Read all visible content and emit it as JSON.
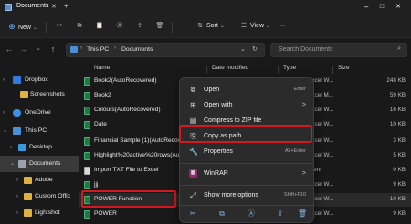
{
  "window": {
    "title": "Documents"
  },
  "toolbar": {
    "new_label": "New",
    "sort_label": "Sort",
    "view_label": "View",
    "more_label": "···"
  },
  "address": {
    "path": [
      "This PC",
      "Documents"
    ],
    "search_placeholder": "Search Documents"
  },
  "sidebar": {
    "items": [
      {
        "label": "Dropbox",
        "expanded": false
      },
      {
        "label": "Screenshots",
        "expanded": false
      },
      {
        "label": "OneDrive",
        "expanded": false
      },
      {
        "label": "This PC",
        "expanded": true
      },
      {
        "label": "Desktop",
        "expanded": false
      },
      {
        "label": "Documents",
        "expanded": true,
        "selected": true
      },
      {
        "label": "Adobe",
        "expanded": false
      },
      {
        "label": "Custom Offic",
        "expanded": false
      },
      {
        "label": "Lightshot",
        "expanded": false
      }
    ]
  },
  "columns": {
    "name": "Name",
    "date": "Date modified",
    "type": "Type",
    "size": "Size"
  },
  "files": [
    {
      "name": "Book2(AutoRecovered)",
      "date": "",
      "type": "Microsoft Excel W...",
      "size": "248 KB",
      "icon": "excel-icon"
    },
    {
      "name": "Book2",
      "date": "",
      "type": "Microsoft Excel M...",
      "size": "59 KB",
      "icon": "excel-icon"
    },
    {
      "name": "Colours(AutoRecovered)",
      "date": "",
      "type": "Microsoft Excel W...",
      "size": "16 KB",
      "icon": "excel-icon"
    },
    {
      "name": "Date",
      "date": "",
      "type": "Microsoft Excel W...",
      "size": "10 KB",
      "icon": "excel-icon"
    },
    {
      "name": "Financial Sample (1)(AutoRecove",
      "date": "",
      "type": "Microsoft Excel W...",
      "size": "3 KB",
      "icon": "excel-icon"
    },
    {
      "name": "Highlight%20active%20rows(Aut",
      "date": "",
      "type": "Microsoft Excel W...",
      "size": "5 KB",
      "icon": "excel-icon"
    },
    {
      "name": "Import TXT File to Excel",
      "date": "",
      "type": "Text Document",
      "size": "0 KB",
      "icon": "text-file-icon"
    },
    {
      "name": "jjj",
      "date": "",
      "type": "Microsoft Excel W...",
      "size": "9 KB",
      "icon": "excel-icon"
    },
    {
      "name": "POWER Function",
      "date": "",
      "type": "Microsoft Excel W...",
      "size": "10 KB",
      "icon": "excel-icon"
    },
    {
      "name": "POWER",
      "date": "",
      "type": "Microsoft Excel W...",
      "size": "9 KB",
      "icon": "excel-icon"
    }
  ],
  "context_menu": {
    "items": [
      {
        "label": "Open",
        "shortcut": "Enter",
        "icon": "open-icon"
      },
      {
        "label": "Open with",
        "shortcut": ">",
        "icon": "open-with-icon"
      },
      {
        "label": "Compress to ZIP file",
        "shortcut": "",
        "icon": "zip-icon"
      },
      {
        "label": "Copy as path",
        "shortcut": "",
        "icon": "copy-path-icon"
      },
      {
        "label": "Properties",
        "shortcut": "Alt+Enter",
        "icon": "properties-icon"
      },
      {
        "label": "WinRAR",
        "shortcut": ">",
        "icon": "winrar-icon"
      },
      {
        "label": "Show more options",
        "shortcut": "Shift+F10",
        "icon": "more-options-icon"
      }
    ]
  },
  "colors": {
    "highlight": "#d3181f",
    "accent": "#5e8cc8",
    "background": "#191919"
  }
}
